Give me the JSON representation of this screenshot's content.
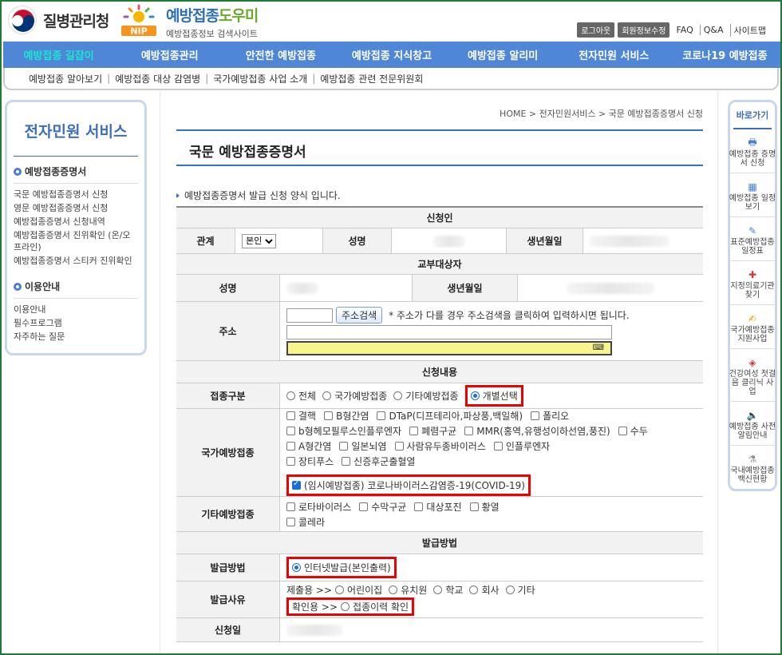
{
  "header": {
    "org_name": "질병관리청",
    "site_logo_text": "NIP",
    "site_title_main": "예방접종",
    "site_title_accent": "도우미",
    "site_subtitle": "예방접종정보 검색사이트",
    "util": [
      "로그아웃",
      "회원정보수정",
      "FAQ",
      "Q&A",
      "사이트맵"
    ]
  },
  "gnb": [
    "예방접종 길잡이",
    "예방접종관리",
    "안전한 예방접종",
    "예방접종 지식창고",
    "예방접종 알리미",
    "전자민원 서비스",
    "코로나19 예방접종"
  ],
  "lnb": [
    "예방접종 알아보기",
    "예방접종 대상 감염병",
    "국가예방접종 사업 소개",
    "예방접종 관련 전문위원회"
  ],
  "sidebar": {
    "title": "전자민원 서비스",
    "section1": "예방접종증명서",
    "links1": [
      "국문 예방접종증명서 신청",
      "영문 예방접종증명서 신청",
      "예방접종증명서 신청내역",
      "예방접종증명서 진위확인 (온/오프라인)",
      "예방접종증명서 스티커 진위확인"
    ],
    "section2": "이용안내",
    "links2": [
      "이용안내",
      "필수프로그램",
      "자주하는 질문"
    ]
  },
  "breadcrumb": "HOME > 전자민원서비스 > 국문 예방접종증명서 신청",
  "page_title": "국문 예방접종증명서",
  "intro": "예방접종증명서 발급 신청 양식 입니다.",
  "form": {
    "applicant_header": "신청인",
    "relation_label": "관계",
    "relation_value": "본인",
    "name_label": "성명",
    "dob_label": "생년월일",
    "recipient_header": "교부대상자",
    "address_label": "주소",
    "address_btn": "주소검색",
    "address_note": "* 주소가 다를 경우 주소검색을 클릭하여 입력하시면 됩니다.",
    "content_header": "신청내용",
    "vac_type_label": "접종구분",
    "vac_types": [
      "전체",
      "국가예방접종",
      "기타예방접종",
      "개별선택"
    ],
    "national_label": "국가예방접종",
    "national_row1": [
      "결핵",
      "B형간염",
      "DTaP(디프테리아,파상풍,백일해)",
      "폴리오"
    ],
    "national_row2": [
      "b형헤모필루스인플루엔자",
      "폐렴구균",
      "MMR(홍역,유행성이하선염,풍진)",
      "수두"
    ],
    "national_row3": [
      "A형간염",
      "일본뇌염",
      "사람유두종바이러스",
      "인플루엔자"
    ],
    "national_row4": [
      "장티푸스",
      "신증후군출혈열"
    ],
    "covid": "(임시예방접종) 코로나바이러스감염증-19(COVID-19)",
    "other_label": "기타예방접종",
    "other_row1": [
      "로타바이러스",
      "수막구균",
      "대상포진",
      "황열"
    ],
    "other_row2": [
      "콜레라"
    ],
    "issue_header": "발급방법",
    "issue_method_label": "발급방법",
    "issue_method": "인터넷발급(본인출력)",
    "reason_label": "발급사유",
    "submit_prefix": "제출용 >>",
    "submit_opts": [
      "어린이집",
      "유치원",
      "학교",
      "회사",
      "기타"
    ],
    "confirm_prefix": "확인용 >>",
    "confirm_opt": "접종이력 확인",
    "date_label": "신청일"
  },
  "quick": {
    "title": "바로가기",
    "items": [
      "예방접종 증명서 신청",
      "예방접종 일정보기",
      "표준예방접종 일정표",
      "지정의료기관 찾기",
      "국가예방접종 지원사업",
      "건강여성 첫걸음 클리닉 사업",
      "예방접종 사전알림안내",
      "국내예방접종 백신현황"
    ]
  }
}
